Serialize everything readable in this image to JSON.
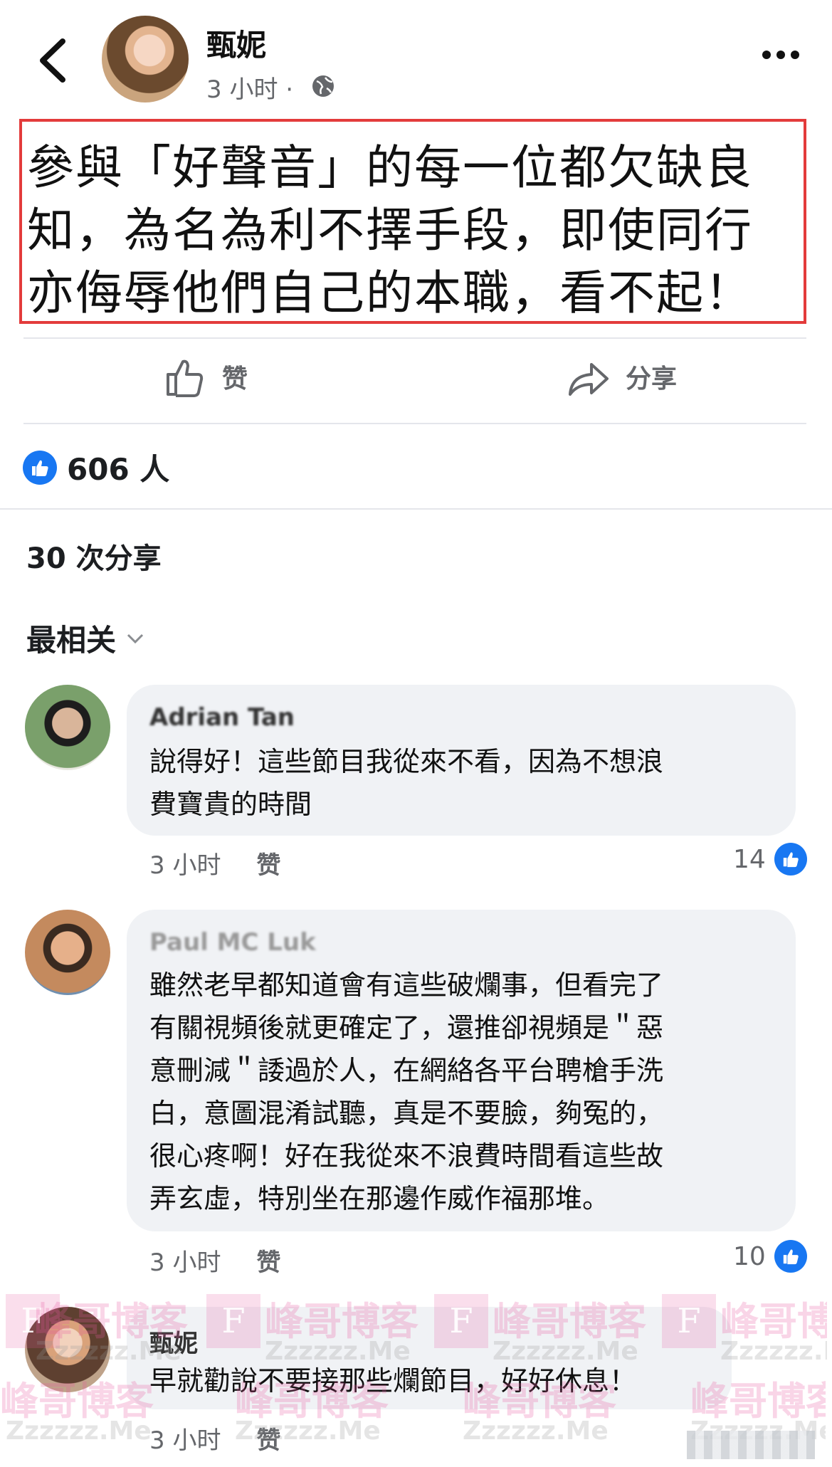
{
  "header": {
    "author": "甄妮",
    "time": "3 小时 ·"
  },
  "post": {
    "lines": [
      "參與「好聲音」的每一位都欠缺良",
      "知，為名為利不擇手段，即使同行",
      "亦侮辱他們自己的本職，看不起！"
    ]
  },
  "actions": {
    "like_label": "赞",
    "share_label": "分享"
  },
  "stats": {
    "likes": "606 人",
    "shares": "30 次分享"
  },
  "sort": {
    "label": "最相关"
  },
  "comments": [
    {
      "name": "Adrian Tan",
      "lines": [
        "說得好！這些節目我從來不看，因為不想浪",
        "費寶貴的時間"
      ],
      "time": "3 小时",
      "like_label": "赞",
      "count": "14"
    },
    {
      "name": "Paul MC Luk",
      "lines": [
        "雖然老早都知道會有這些破爛事，但看完了",
        "有關視頻後就更確定了，還推卻視頻是＂惡",
        "意刪減＂諉過於人，在網絡各平台聘槍手洗",
        "白，意圖混淆試聽，真是不要臉，夠冤的，",
        "很心疼啊！好在我從來不浪費時間看這些故",
        "弄玄虛，特別坐在那邊作威作福那堆。"
      ],
      "time": "3 小时",
      "like_label": "赞",
      "count": "10"
    },
    {
      "name": "甄妮",
      "lines": [
        "早就勸說不要接那些爛節目，好好休息！"
      ],
      "time": "3 小时",
      "like_label": "赞"
    }
  ],
  "watermark": {
    "text": "峰哥博客",
    "sub": "Zzzzzz.Me",
    "letter": "F"
  },
  "colors": {
    "accent": "#1877f2",
    "post_border": "#e33b3b",
    "bubble": "#f0f2f5",
    "muted": "#65676b"
  }
}
